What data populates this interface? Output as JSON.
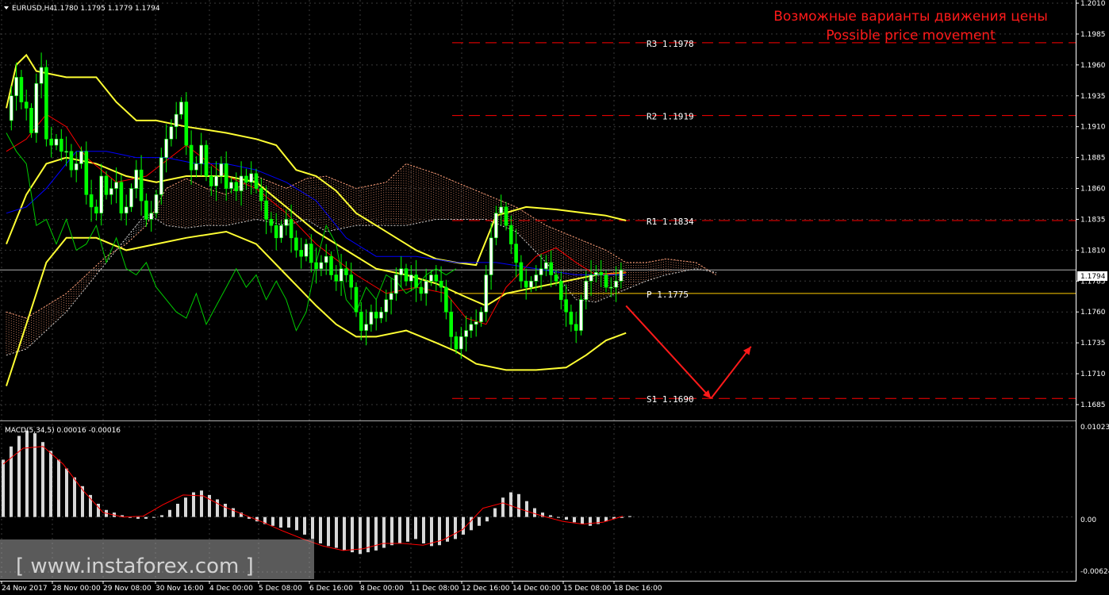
{
  "header": {
    "symbol": "EURUSD,H4",
    "ohlc": "1.1780 1.1795 1.1779 1.1794",
    "title_ru": "Возможные варианты движения цены",
    "title_en": "Possible price movement"
  },
  "macd": {
    "label": "MACD(5,34,5) 0.00016 -0.00016",
    "axis_top": "0.01023",
    "axis_zero": "0.00",
    "axis_bottom": "-0.00624"
  },
  "watermark": "[ www.instaforex.com ]",
  "current_price": "1.1794",
  "colors": {
    "background": "#000000",
    "bull_candle": "#ffffff",
    "bear_candle": "#00ff00",
    "bollinger": "#ffff33",
    "pivot_line": "#ff0000",
    "p_line": "#ffcc00",
    "arrow": "#ff1a1a",
    "tenkan": "#ff0000",
    "kijun": "#0000ff",
    "chikou": "#00cc00",
    "cloud_up": "#ffa07a",
    "cloud_down": "#ffffff",
    "macd_hist": "#d8d8d8",
    "macd_signal": "#ff0000"
  },
  "chart_data": {
    "type": "candlestick",
    "symbol": "EURUSD",
    "timeframe": "H4",
    "ylim": [
      1.1676,
      1.201
    ],
    "y_ticks": [
      "1.2010",
      "1.1985",
      "1.1960",
      "1.1935",
      "1.1910",
      "1.1885",
      "1.1860",
      "1.1835",
      "1.1810",
      "1.1785",
      "1.1760",
      "1.1735",
      "1.1710",
      "1.1685"
    ],
    "x_ticks": [
      "24 Nov 2017",
      "28 Nov 00:00",
      "29 Nov 08:00",
      "30 Nov 16:00",
      "4 Dec 00:00",
      "5 Dec 08:00",
      "6 Dec 16:00",
      "8 Dec 00:00",
      "11 Dec 08:00",
      "12 Dec 16:00",
      "14 Dec 00:00",
      "15 Dec 08:00",
      "18 Dec 16:00"
    ],
    "levels": [
      {
        "name": "R3",
        "value": 1.1978,
        "label": "R3 1.1978"
      },
      {
        "name": "R2",
        "value": 1.1919,
        "label": "R2 1.1919"
      },
      {
        "name": "R1",
        "value": 1.1834,
        "label": "R1 1.1834"
      },
      {
        "name": "P",
        "value": 1.1775,
        "label": "P 1.1775"
      },
      {
        "name": "S1",
        "value": 1.169,
        "label": "S1 1.1690"
      }
    ],
    "price_path": [
      1.1915,
      1.1935,
      1.195,
      1.193,
      1.1925,
      1.1905,
      1.1945,
      1.1958,
      1.19,
      1.1895,
      1.19,
      1.189,
      1.189,
      1.1875,
      1.188,
      1.189,
      1.1855,
      1.1845,
      1.184,
      1.187,
      1.1855,
      1.186,
      1.1865,
      1.184,
      1.1845,
      1.186,
      1.1875,
      1.185,
      1.1835,
      1.184,
      1.1855,
      1.1885,
      1.19,
      1.191,
      1.192,
      1.193,
      1.1895,
      1.1875,
      1.188,
      1.1895,
      1.187,
      1.1862,
      1.187,
      1.188,
      1.186,
      1.1865,
      1.1858,
      1.187,
      1.1865,
      1.1872,
      1.186,
      1.185,
      1.1835,
      1.183,
      1.182,
      1.183,
      1.1835,
      1.182,
      1.181,
      1.1805,
      1.1815,
      1.18,
      1.1795,
      1.18,
      1.1805,
      1.179,
      1.1785,
      1.1795,
      1.179,
      1.178,
      1.176,
      1.1745,
      1.175,
      1.176,
      1.1755,
      1.176,
      1.177,
      1.1775,
      1.179,
      1.1795,
      1.1785,
      1.179,
      1.178,
      1.1775,
      1.1785,
      1.179,
      1.1785,
      1.178,
      1.176,
      1.174,
      1.173,
      1.174,
      1.1745,
      1.175,
      1.1752,
      1.176,
      1.179,
      1.182,
      1.184,
      1.1845,
      1.183,
      1.1815,
      1.18,
      1.1785,
      1.178,
      1.1785,
      1.179,
      1.1795,
      1.18,
      1.179,
      1.1785,
      1.177,
      1.176,
      1.175,
      1.1745,
      1.177,
      1.1785,
      1.179,
      1.1792,
      1.179,
      1.178,
      1.178,
      1.1785,
      1.1794
    ],
    "bollinger": {
      "upper": [
        [
          0,
          1.1925
        ],
        [
          2,
          1.196
        ],
        [
          4,
          1.1968
        ],
        [
          6,
          1.1955
        ],
        [
          12,
          1.195
        ],
        [
          18,
          1.195
        ],
        [
          22,
          1.193
        ],
        [
          26,
          1.1915
        ],
        [
          30,
          1.1915
        ],
        [
          36,
          1.191
        ],
        [
          44,
          1.1905
        ],
        [
          50,
          1.19
        ],
        [
          54,
          1.1895
        ],
        [
          58,
          1.1875
        ],
        [
          62,
          1.187
        ],
        [
          66,
          1.1858
        ],
        [
          70,
          1.184
        ],
        [
          74,
          1.183
        ],
        [
          78,
          1.182
        ],
        [
          82,
          1.181
        ],
        [
          86,
          1.1803
        ],
        [
          90,
          1.18
        ],
        [
          94,
          1.1798
        ],
        [
          98,
          1.1838
        ],
        [
          104,
          1.1845
        ],
        [
          110,
          1.1843
        ],
        [
          116,
          1.184
        ],
        [
          120,
          1.1838
        ],
        [
          124,
          1.1834
        ]
      ],
      "middle": [
        [
          0,
          1.1815
        ],
        [
          4,
          1.1855
        ],
        [
          8,
          1.188
        ],
        [
          12,
          1.1885
        ],
        [
          18,
          1.188
        ],
        [
          24,
          1.187
        ],
        [
          30,
          1.1865
        ],
        [
          36,
          1.187
        ],
        [
          44,
          1.187
        ],
        [
          50,
          1.1865
        ],
        [
          56,
          1.1845
        ],
        [
          62,
          1.1825
        ],
        [
          68,
          1.181
        ],
        [
          74,
          1.1795
        ],
        [
          80,
          1.179
        ],
        [
          86,
          1.1783
        ],
        [
          92,
          1.1772
        ],
        [
          96,
          1.1765
        ],
        [
          100,
          1.1775
        ],
        [
          106,
          1.178
        ],
        [
          112,
          1.1785
        ],
        [
          118,
          1.179
        ],
        [
          124,
          1.1792
        ]
      ],
      "lower": [
        [
          0,
          1.17
        ],
        [
          4,
          1.175
        ],
        [
          8,
          1.18
        ],
        [
          12,
          1.182
        ],
        [
          18,
          1.182
        ],
        [
          24,
          1.181
        ],
        [
          30,
          1.1815
        ],
        [
          36,
          1.182
        ],
        [
          44,
          1.1825
        ],
        [
          50,
          1.1815
        ],
        [
          56,
          1.179
        ],
        [
          62,
          1.1765
        ],
        [
          66,
          1.175
        ],
        [
          70,
          1.174
        ],
        [
          74,
          1.174
        ],
        [
          80,
          1.1745
        ],
        [
          86,
          1.1735
        ],
        [
          90,
          1.1728
        ],
        [
          94,
          1.1718
        ],
        [
          100,
          1.1713
        ],
        [
          106,
          1.1713
        ],
        [
          112,
          1.1715
        ],
        [
          116,
          1.1725
        ],
        [
          120,
          1.1737
        ],
        [
          124,
          1.1743
        ]
      ]
    },
    "tenkan": [
      [
        0,
        1.189
      ],
      [
        4,
        1.19
      ],
      [
        8,
        1.192
      ],
      [
        12,
        1.191
      ],
      [
        16,
        1.1885
      ],
      [
        22,
        1.1865
      ],
      [
        28,
        1.187
      ],
      [
        36,
        1.1895
      ],
      [
        44,
        1.187
      ],
      [
        50,
        1.186
      ],
      [
        56,
        1.184
      ],
      [
        62,
        1.1815
      ],
      [
        70,
        1.179
      ],
      [
        76,
        1.1775
      ],
      [
        82,
        1.178
      ],
      [
        88,
        1.1775
      ],
      [
        92,
        1.1755
      ],
      [
        96,
        1.175
      ],
      [
        100,
        1.178
      ],
      [
        106,
        1.1805
      ],
      [
        110,
        1.1812
      ],
      [
        114,
        1.18
      ],
      [
        118,
        1.179
      ],
      [
        124,
        1.1792
      ]
    ],
    "kijun": [
      [
        0,
        1.184
      ],
      [
        4,
        1.1845
      ],
      [
        8,
        1.186
      ],
      [
        14,
        1.189
      ],
      [
        20,
        1.189
      ],
      [
        26,
        1.1885
      ],
      [
        32,
        1.1885
      ],
      [
        38,
        1.188
      ],
      [
        44,
        1.188
      ],
      [
        50,
        1.1875
      ],
      [
        56,
        1.1865
      ],
      [
        62,
        1.185
      ],
      [
        68,
        1.182
      ],
      [
        74,
        1.1805
      ],
      [
        82,
        1.1805
      ],
      [
        90,
        1.18
      ],
      [
        98,
        1.18
      ],
      [
        106,
        1.1795
      ],
      [
        114,
        1.179
      ],
      [
        124,
        1.179
      ]
    ],
    "chikou": [
      [
        0,
        1.1905
      ],
      [
        2,
        1.189
      ],
      [
        4,
        1.188
      ],
      [
        6,
        1.183
      ],
      [
        8,
        1.1835
      ],
      [
        10,
        1.1815
      ],
      [
        12,
        1.1835
      ],
      [
        14,
        1.181
      ],
      [
        16,
        1.1815
      ],
      [
        18,
        1.183
      ],
      [
        20,
        1.18
      ],
      [
        22,
        1.182
      ],
      [
        24,
        1.1795
      ],
      [
        26,
        1.179
      ],
      [
        28,
        1.18
      ],
      [
        30,
        1.178
      ],
      [
        32,
        1.177
      ],
      [
        34,
        1.176
      ],
      [
        36,
        1.1755
      ],
      [
        38,
        1.1775
      ],
      [
        40,
        1.175
      ],
      [
        42,
        1.1765
      ],
      [
        44,
        1.178
      ],
      [
        46,
        1.1795
      ],
      [
        48,
        1.178
      ],
      [
        50,
        1.179
      ],
      [
        52,
        1.177
      ],
      [
        54,
        1.1785
      ],
      [
        56,
        1.177
      ],
      [
        58,
        1.1745
      ],
      [
        60,
        1.176
      ],
      [
        62,
        1.18
      ],
      [
        64,
        1.183
      ],
      [
        66,
        1.1815
      ],
      [
        68,
        1.177
      ],
      [
        70,
        1.176
      ],
      [
        72,
        1.178
      ],
      [
        74,
        1.177
      ],
      [
        76,
        1.179
      ],
      [
        78,
        1.1785
      ],
      [
        80,
        1.1775
      ],
      [
        82,
        1.178
      ],
      [
        84,
        1.179
      ],
      [
        86,
        1.1795
      ],
      [
        88,
        1.179
      ],
      [
        90,
        1.1795
      ]
    ],
    "cloud_a": [
      [
        0,
        1.176
      ],
      [
        4,
        1.1755
      ],
      [
        8,
        1.1765
      ],
      [
        12,
        1.1775
      ],
      [
        16,
        1.179
      ],
      [
        20,
        1.1805
      ],
      [
        24,
        1.1815
      ],
      [
        28,
        1.183
      ],
      [
        32,
        1.186
      ],
      [
        36,
        1.1868
      ],
      [
        40,
        1.186
      ],
      [
        44,
        1.1855
      ],
      [
        50,
        1.187
      ],
      [
        56,
        1.186
      ],
      [
        60,
        1.1868
      ],
      [
        64,
        1.187
      ],
      [
        70,
        1.186
      ],
      [
        76,
        1.1865
      ],
      [
        80,
        1.188
      ],
      [
        86,
        1.1872
      ],
      [
        90,
        1.1865
      ],
      [
        96,
        1.1855
      ],
      [
        102,
        1.1845
      ],
      [
        108,
        1.183
      ],
      [
        114,
        1.182
      ],
      [
        120,
        1.181
      ],
      [
        124,
        1.18
      ],
      [
        128,
        1.18
      ],
      [
        132,
        1.1803
      ],
      [
        138,
        1.18
      ],
      [
        142,
        1.179
      ]
    ],
    "cloud_b": [
      [
        0,
        1.1725
      ],
      [
        4,
        1.173
      ],
      [
        8,
        1.1745
      ],
      [
        12,
        1.176
      ],
      [
        16,
        1.178
      ],
      [
        20,
        1.18
      ],
      [
        24,
        1.182
      ],
      [
        28,
        1.184
      ],
      [
        32,
        1.183
      ],
      [
        36,
        1.1828
      ],
      [
        40,
        1.183
      ],
      [
        44,
        1.183
      ],
      [
        50,
        1.1835
      ],
      [
        56,
        1.183
      ],
      [
        60,
        1.1835
      ],
      [
        64,
        1.1825
      ],
      [
        70,
        1.183
      ],
      [
        76,
        1.183
      ],
      [
        80,
        1.183
      ],
      [
        86,
        1.1835
      ],
      [
        90,
        1.1835
      ],
      [
        96,
        1.1835
      ],
      [
        102,
        1.1825
      ],
      [
        108,
        1.18
      ],
      [
        114,
        1.177
      ],
      [
        118,
        1.1768
      ],
      [
        122,
        1.1775
      ],
      [
        128,
        1.1785
      ],
      [
        132,
        1.179
      ],
      [
        138,
        1.1795
      ],
      [
        142,
        1.1792
      ]
    ],
    "forecast": {
      "points": [
        [
          124,
          1.1765
        ],
        [
          141,
          1.169
        ],
        [
          149,
          1.1732
        ]
      ],
      "description": "decline from the price near P toward S1 1.1690, then rebound"
    },
    "macd": {
      "type": "bar",
      "ylim": [
        -0.00624,
        0.01023
      ],
      "histogram": [
        0.0065,
        0.008,
        0.0092,
        0.0098,
        0.0095,
        0.0085,
        0.0075,
        0.0065,
        0.0055,
        0.0045,
        0.0035,
        0.0025,
        0.0015,
        0.0008,
        0.0005,
        0.0002,
        0.0,
        -0.0002,
        -0.0002,
        0.0,
        0.0002,
        0.0008,
        0.0015,
        0.0022,
        0.0028,
        0.003,
        0.0025,
        0.002,
        0.0015,
        0.001,
        0.0005,
        -0.0002,
        -0.0005,
        -0.0008,
        -0.001,
        -0.0012,
        -0.0012,
        -0.0015,
        -0.002,
        -0.0025,
        -0.003,
        -0.0033,
        -0.0035,
        -0.0038,
        -0.004,
        -0.0042,
        -0.004,
        -0.0038,
        -0.0035,
        -0.0032,
        -0.003,
        -0.0028,
        -0.0025,
        -0.003,
        -0.0033,
        -0.0032,
        -0.0028,
        -0.0025,
        -0.002,
        -0.0015,
        -0.001,
        -0.0005,
        0.001,
        0.0022,
        0.0028,
        0.0026,
        0.0018,
        0.001,
        0.0005,
        0.0002,
        0.0,
        -0.0003,
        -0.0006,
        -0.0008,
        -0.001,
        -0.0008,
        -0.0005,
        -0.0002,
        -0.0001,
        0.0001
      ],
      "signal": [
        [
          0,
          0.006
        ],
        [
          4,
          0.0078
        ],
        [
          8,
          0.008
        ],
        [
          12,
          0.006
        ],
        [
          16,
          0.003
        ],
        [
          20,
          0.0005
        ],
        [
          24,
          0.0
        ],
        [
          28,
          0.0001
        ],
        [
          32,
          0.0014
        ],
        [
          36,
          0.0025
        ],
        [
          40,
          0.0024
        ],
        [
          44,
          0.0012
        ],
        [
          48,
          0.0003
        ],
        [
          52,
          -0.0006
        ],
        [
          56,
          -0.0016
        ],
        [
          60,
          -0.0025
        ],
        [
          64,
          -0.0033
        ],
        [
          68,
          -0.0038
        ],
        [
          72,
          -0.0036
        ],
        [
          76,
          -0.003
        ],
        [
          80,
          -0.003
        ],
        [
          84,
          -0.0032
        ],
        [
          88,
          -0.0026
        ],
        [
          92,
          -0.0014
        ],
        [
          96,
          0.001
        ],
        [
          100,
          0.0016
        ],
        [
          104,
          0.0008
        ],
        [
          108,
          0.0001
        ],
        [
          112,
          -0.0005
        ],
        [
          116,
          -0.0008
        ],
        [
          120,
          -0.0006
        ],
        [
          124,
          0.0001
        ]
      ]
    }
  }
}
